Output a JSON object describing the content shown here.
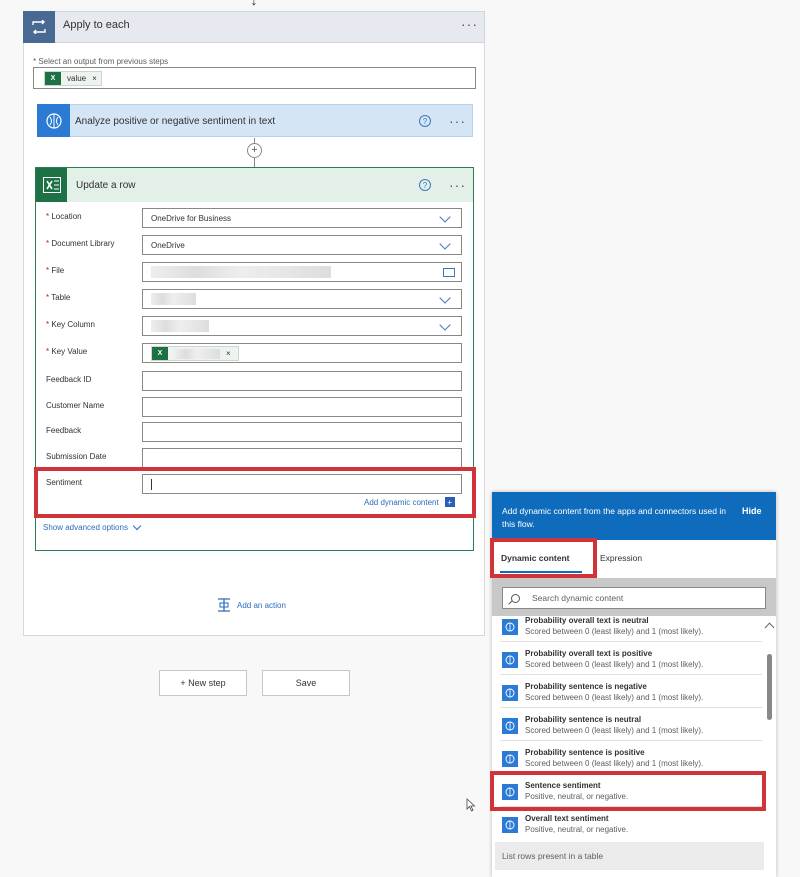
{
  "apply_each": {
    "title": "Apply to each",
    "select_label": "* Select an output from previous steps",
    "token_icon": "X",
    "token_label": "value",
    "token_remove": "×"
  },
  "analyze": {
    "title": "Analyze positive or negative sentiment in text",
    "help": "?"
  },
  "update_row": {
    "title": "Update a row",
    "help": "?",
    "fields": [
      {
        "label": "Location",
        "required": true,
        "value": "OneDrive for Business"
      },
      {
        "label": "Document Library",
        "required": true,
        "value": "OneDrive"
      },
      {
        "label": "File",
        "required": true,
        "value": ""
      },
      {
        "label": "Table",
        "required": true,
        "value": ""
      },
      {
        "label": "Key Column",
        "required": true,
        "value": ""
      },
      {
        "label": "Key Value",
        "required": true,
        "value": ""
      },
      {
        "label": "Feedback ID",
        "required": false,
        "value": ""
      },
      {
        "label": "Customer Name",
        "required": false,
        "value": ""
      },
      {
        "label": "Feedback",
        "required": false,
        "value": ""
      },
      {
        "label": "Submission Date",
        "required": false,
        "value": ""
      },
      {
        "label": "Sentiment",
        "required": false,
        "value": ""
      }
    ],
    "key_value_remove": "×",
    "add_dynamic_content": "Add dynamic content",
    "show_advanced": "Show advanced options"
  },
  "add_action": "Add an action",
  "new_step": "+ New step",
  "save": "Save",
  "panel": {
    "header": "Add dynamic content from the apps and connectors used in this flow.",
    "hide": "Hide",
    "tabs": [
      "Dynamic content",
      "Expression"
    ],
    "search_placeholder": "Search dynamic content",
    "items": [
      {
        "title": "Probability overall text is neutral",
        "sub": "Scored between 0 (least likely) and 1 (most likely)."
      },
      {
        "title": "Probability overall text is positive",
        "sub": "Scored between 0 (least likely) and 1 (most likely)."
      },
      {
        "title": "Probability sentence is negative",
        "sub": "Scored between 0 (least likely) and 1 (most likely)."
      },
      {
        "title": "Probability sentence is neutral",
        "sub": "Scored between 0 (least likely) and 1 (most likely)."
      },
      {
        "title": "Probability sentence is positive",
        "sub": "Scored between 0 (least likely) and 1 (most likely)."
      },
      {
        "title": "Sentence sentiment",
        "sub": "Positive, neutral, or negative."
      },
      {
        "title": "Overall text sentiment",
        "sub": "Positive, neutral, or negative."
      }
    ],
    "section": "List rows present in a table"
  },
  "colors": {
    "accent": "#0f6cbd",
    "excel": "#1e7145",
    "highlight": "#d13438",
    "analyze": "#2b7bd4"
  }
}
